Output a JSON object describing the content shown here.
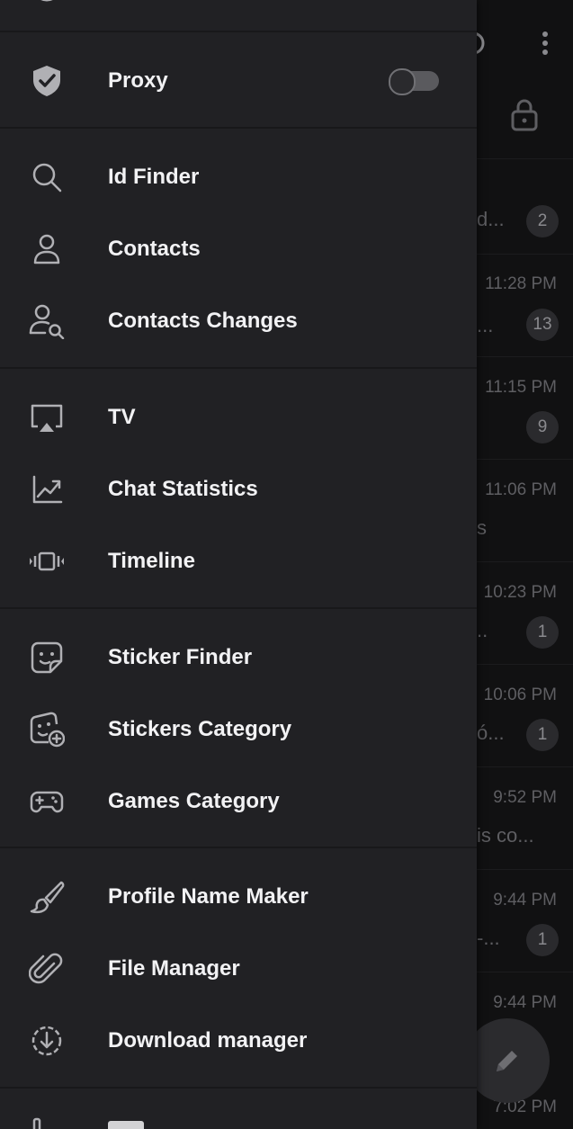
{
  "drawer": {
    "sections": [
      {
        "items": [
          {
            "id": "proxy",
            "label": "Proxy",
            "icon": "shield-check-icon",
            "toggle": false
          }
        ]
      },
      {
        "items": [
          {
            "id": "id-finder",
            "label": "Id Finder",
            "icon": "search-icon"
          },
          {
            "id": "contacts",
            "label": "Contacts",
            "icon": "person-icon"
          },
          {
            "id": "contacts-changes",
            "label": "Contacts Changes",
            "icon": "person-search-icon"
          }
        ]
      },
      {
        "items": [
          {
            "id": "tv",
            "label": "TV",
            "icon": "airplay-icon"
          },
          {
            "id": "chat-statistics",
            "label": "Chat Statistics",
            "icon": "chart-up-icon"
          },
          {
            "id": "timeline",
            "label": "Timeline",
            "icon": "timeline-icon"
          }
        ]
      },
      {
        "items": [
          {
            "id": "sticker-finder",
            "label": "Sticker Finder",
            "icon": "sticker-icon"
          },
          {
            "id": "stickers-category",
            "label": "Stickers Category",
            "icon": "sticker-add-icon"
          },
          {
            "id": "games-category",
            "label": "Games Category",
            "icon": "gamepad-icon"
          }
        ]
      },
      {
        "items": [
          {
            "id": "profile-name-maker",
            "label": "Profile Name Maker",
            "icon": "brush-icon"
          },
          {
            "id": "file-manager",
            "label": "File Manager",
            "icon": "paperclip-icon"
          },
          {
            "id": "download-manager",
            "label": "Download manager",
            "icon": "download-circle-icon"
          }
        ]
      }
    ]
  },
  "background_chats": [
    {
      "snippet": "d...",
      "time": "",
      "badge": "2"
    },
    {
      "snippet": "...",
      "time": "11:28 PM",
      "badge": "13"
    },
    {
      "snippet": "",
      "time": "11:15 PM",
      "badge": "9"
    },
    {
      "snippet": "s",
      "time": "11:06 PM",
      "badge": ""
    },
    {
      "snippet": "..",
      "time": "10:23 PM",
      "badge": "1"
    },
    {
      "snippet": "ó...",
      "time": "10:06 PM",
      "badge": "1"
    },
    {
      "snippet": "is co...",
      "time": "9:52 PM",
      "badge": ""
    },
    {
      "snippet": "-...",
      "time": "9:44 PM",
      "badge": "1"
    },
    {
      "snippet": "",
      "time": "9:44 PM",
      "badge": ""
    },
    {
      "snippet": "",
      "time": "7:02 PM",
      "badge": ""
    }
  ],
  "colors": {
    "drawer_bg": "#212124",
    "text": "#f2f2f4",
    "icon": "#b0b0b4",
    "separator": "#18181a"
  }
}
